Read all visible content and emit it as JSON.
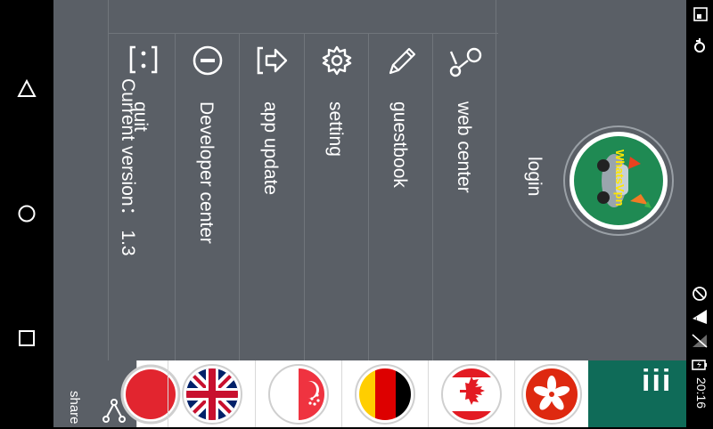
{
  "menu": {
    "login_label": "login",
    "logo_text": "WhatsVpn",
    "items": [
      {
        "label": "web center",
        "icon": "web-center-icon"
      },
      {
        "label": "guestbook",
        "icon": "pencil-icon"
      },
      {
        "label": "setting",
        "icon": "gear-icon"
      },
      {
        "label": "app update",
        "icon": "update-icon"
      },
      {
        "label": "Developer center",
        "icon": "minus-circle-icon"
      },
      {
        "label": "quit",
        "icon": "quit-icon"
      }
    ],
    "version_text": "Current version： 1.3"
  },
  "bottom_bar": {
    "share_label": "share",
    "servers": [
      "hong-kong",
      "canada",
      "germany",
      "singapore",
      "united-kingdom",
      "partial-flag"
    ],
    "menu_glyph": "iii"
  },
  "status": {
    "time": "20:16"
  },
  "colors": {
    "drawer": "#5a5f66",
    "accent_green": "#0f6b58"
  }
}
